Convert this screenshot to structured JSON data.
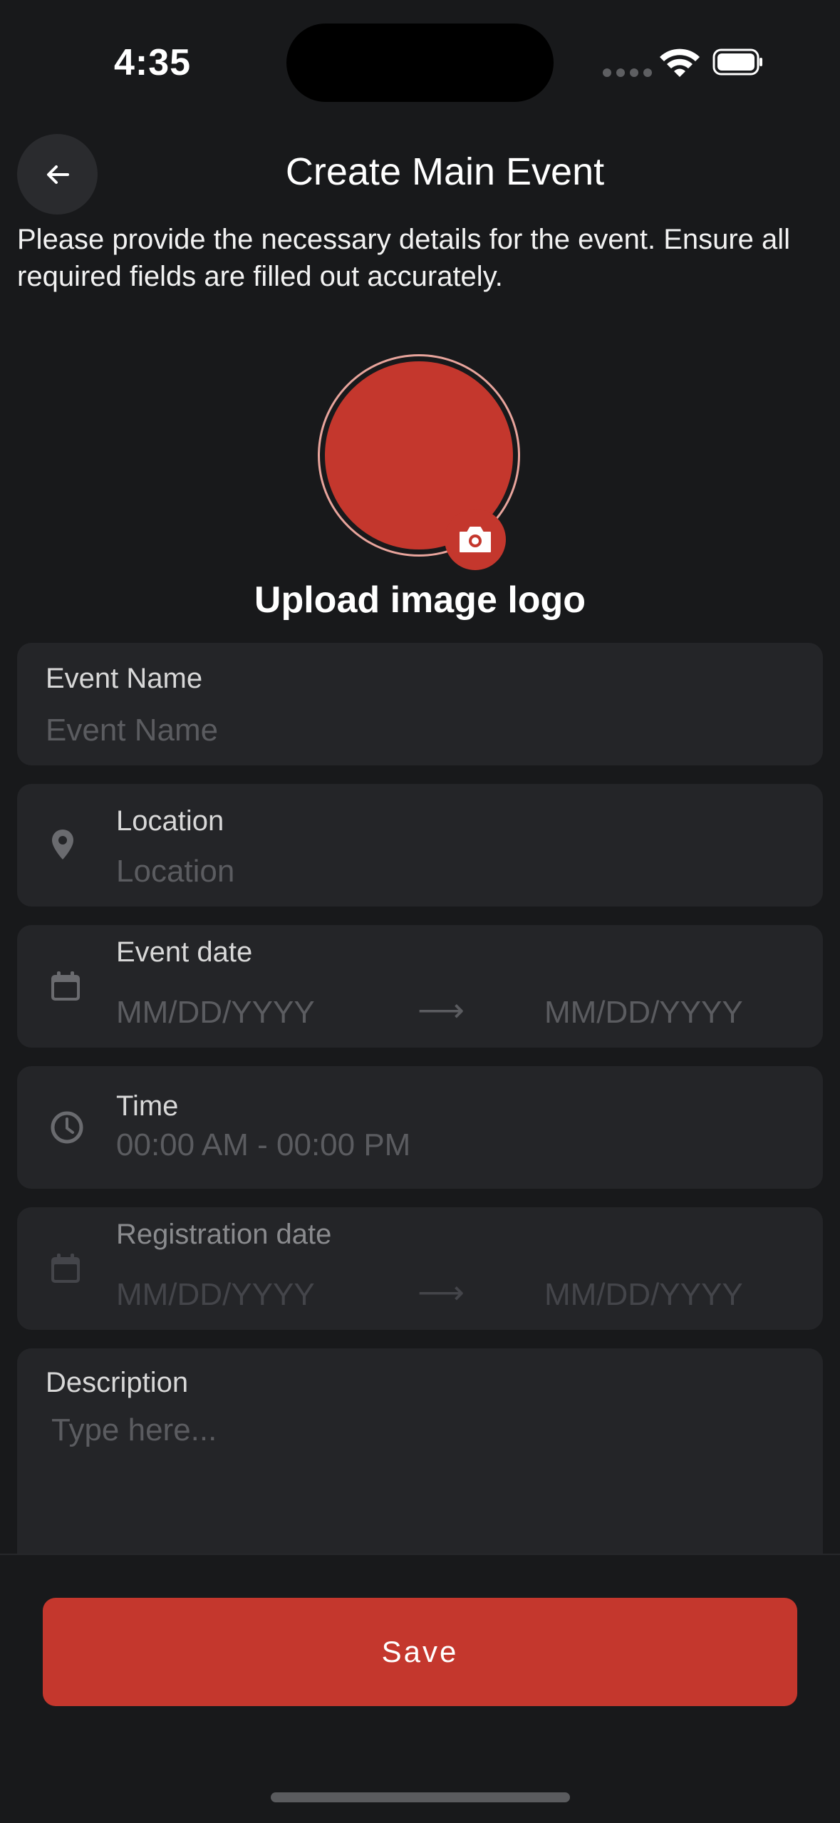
{
  "status_bar": {
    "time": "4:35"
  },
  "header": {
    "title": "Create Main Event",
    "intro": "Please provide the necessary details for the event. Ensure all required fields are filled out accurately."
  },
  "logo": {
    "label": "Upload image logo"
  },
  "fields": {
    "event_name": {
      "label": "Event Name",
      "placeholder": "Event Name"
    },
    "location": {
      "label": "Location",
      "placeholder": "Location",
      "icon": "location-pin-icon"
    },
    "event_date": {
      "label": "Event date",
      "start_placeholder": "MM/DD/YYYY",
      "end_placeholder": "MM/DD/YYYY",
      "icon": "calendar-icon"
    },
    "time": {
      "label": "Time",
      "placeholder": "00:00 AM - 00:00 PM",
      "icon": "clock-icon"
    },
    "registration_date": {
      "label": "Registration date",
      "start_placeholder": "MM/DD/YYYY",
      "end_placeholder": "MM/DD/YYYY",
      "icon": "calendar-icon"
    },
    "description": {
      "label": "Description",
      "placeholder": "Type here..."
    }
  },
  "footer": {
    "save_label": "Save"
  },
  "colors": {
    "accent": "#c4372d",
    "background": "#18191b",
    "card": "#242528"
  }
}
